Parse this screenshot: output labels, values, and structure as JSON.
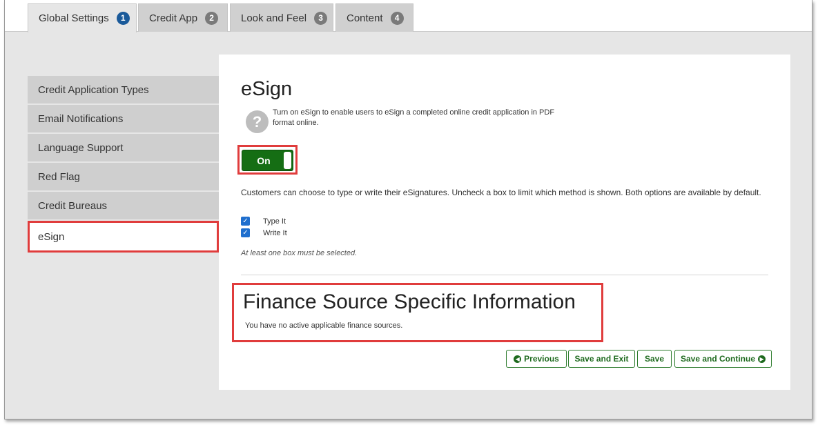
{
  "tabs": [
    {
      "label": "Global Settings",
      "num": "1"
    },
    {
      "label": "Credit App",
      "num": "2"
    },
    {
      "label": "Look and Feel",
      "num": "3"
    },
    {
      "label": "Content",
      "num": "4"
    }
  ],
  "sidebar": {
    "items": [
      {
        "label": "Credit Application Types"
      },
      {
        "label": "Email Notifications"
      },
      {
        "label": "Language Support"
      },
      {
        "label": "Red Flag"
      },
      {
        "label": "Credit Bureaus"
      },
      {
        "label": "eSign"
      }
    ],
    "active": "eSign"
  },
  "esign": {
    "title": "eSign",
    "help_icon": "?",
    "help_text": "Turn on eSign to enable users to eSign a completed online credit application in PDF format online.",
    "toggle_label": "On",
    "customers_text": "Customers can choose to type or write their eSignatures. Uncheck a box to limit which method is shown. Both options are available by default.",
    "options": [
      {
        "label": "Type It",
        "checked": true
      },
      {
        "label": "Write It",
        "checked": true
      }
    ],
    "note": "At least one box must be selected."
  },
  "finance": {
    "title": "Finance Source Specific Information",
    "text": "You have no active applicable finance sources."
  },
  "buttons": {
    "previous": "Previous",
    "save_exit": "Save and Exit",
    "save": "Save",
    "save_continue": "Save and Continue"
  },
  "colors": {
    "accent_green": "#156e14",
    "highlight_red": "#e03c3c",
    "active_tab_badge": "#1a5a9a"
  }
}
